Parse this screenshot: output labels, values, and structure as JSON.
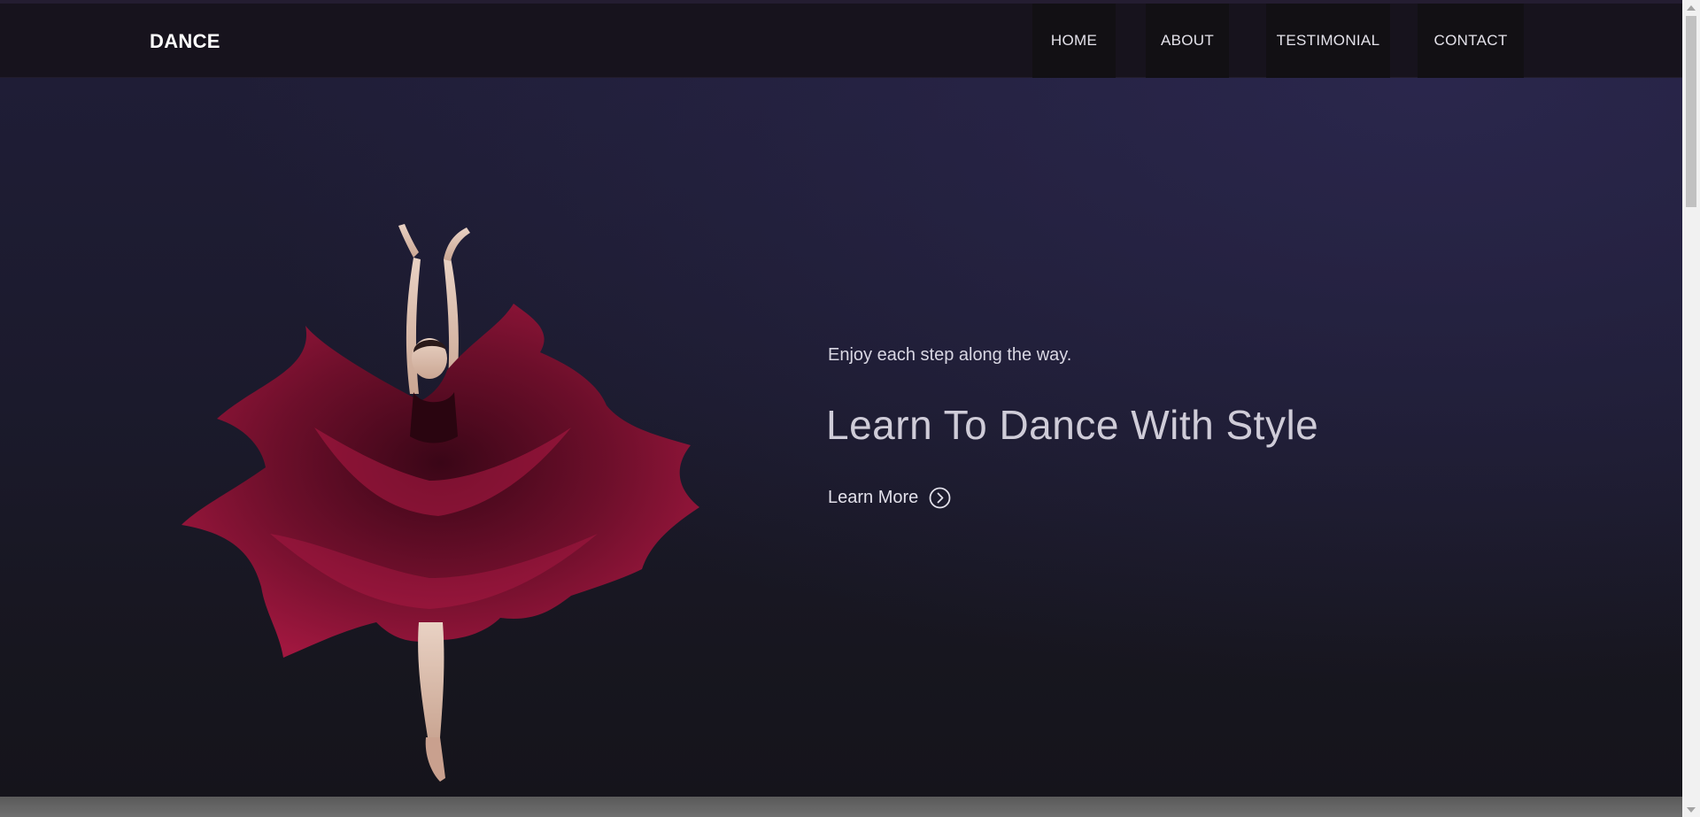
{
  "header": {
    "brand": "DANCE",
    "nav": [
      {
        "label": "HOME"
      },
      {
        "label": "ABOUT"
      },
      {
        "label": "TESTIMONIAL"
      },
      {
        "label": "CONTACT"
      }
    ]
  },
  "hero": {
    "subtitle": "Enjoy each step along the way.",
    "title": "Learn To Dance With Style",
    "cta_label": "Learn More",
    "cta_icon": "chevron-right-circle-icon",
    "image": "ballerina-red-dress"
  },
  "colors": {
    "header_bg": "#17131d",
    "hero_top": "#1f1d36",
    "hero_bottom": "#15141b",
    "dress": "#8a1336",
    "text": "#cfccd8"
  }
}
